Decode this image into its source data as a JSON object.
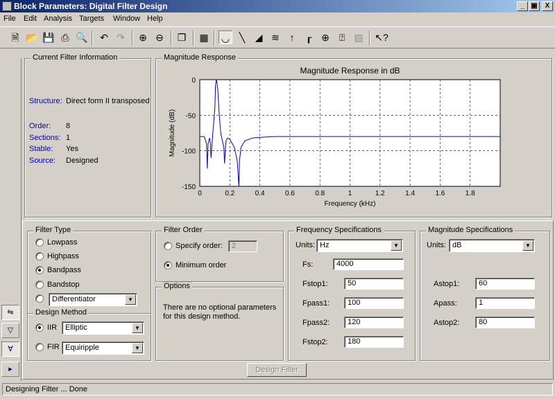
{
  "window": {
    "title": "Block Parameters: Digital Filter Design",
    "controls": [
      "_",
      "▣",
      "X"
    ]
  },
  "menu": [
    "File",
    "Edit",
    "Analysis",
    "Targets",
    "Window",
    "Help"
  ],
  "toolbar_icons": [
    "new-icon",
    "open-icon",
    "save-icon",
    "print-icon",
    "print-preview-icon",
    "undo-icon",
    "redo-icon",
    "zoom-in-icon",
    "zoom-out-icon",
    "full-view-icon",
    "filter-structure-icon",
    "magnitude-response-icon",
    "phase-response-icon",
    "magnitude-phase-icon",
    "group-delay-icon",
    "impulse-response-icon",
    "step-response-icon",
    "pole-zero-icon",
    "filter-coefficients-icon",
    "filter-information-icon",
    "whats-this-help-icon"
  ],
  "filter_info": {
    "title": "Current Filter Information",
    "structure_label": "Structure:",
    "structure_value": "Direct form II transposed",
    "order_label": "Order:",
    "order_value": "8",
    "sections_label": "Sections:",
    "sections_value": "1",
    "stable_label": "Stable:",
    "stable_value": "Yes",
    "source_label": "Source:",
    "source_value": "Designed"
  },
  "magnitude": {
    "group_title": "Magnitude Response",
    "chart_data": {
      "type": "line",
      "title": "Magnitude Response in dB",
      "xlabel": "Frequency (kHz)",
      "ylabel": "Magnitude (dB)",
      "xlim": [
        0,
        2
      ],
      "ylim": [
        -150,
        0
      ],
      "x_ticks": [
        "0",
        "0.2",
        "0.4",
        "0.6",
        "0.8",
        "1",
        "1.2",
        "1.4",
        "1.6",
        "1.8"
      ],
      "y_ticks": [
        "0",
        "-50",
        "-100",
        "-150"
      ],
      "grid": true,
      "color": "#0000c0",
      "series": [
        {
          "x": [
            0,
            0.03,
            0.045,
            0.05,
            0.055,
            0.065,
            0.07,
            0.075,
            0.085,
            0.1,
            0.105,
            0.11,
            0.115,
            0.12,
            0.13,
            0.14,
            0.16,
            0.165,
            0.17,
            0.175,
            0.185,
            0.2,
            0.23,
            0.25,
            0.26,
            0.265,
            0.275,
            0.3,
            0.35,
            0.4,
            0.5,
            0.6,
            0.8,
            1.0,
            1.2,
            1.4,
            1.6,
            1.8,
            2.0
          ],
          "y": [
            -80,
            -80,
            -90,
            -125,
            -90,
            -82,
            -88,
            -110,
            -80,
            -40,
            -8,
            0,
            -5,
            -15,
            -50,
            -76,
            -95,
            -118,
            -98,
            -86,
            -82,
            -84,
            -95,
            -115,
            -150,
            -112,
            -95,
            -86,
            -82,
            -81,
            -80,
            -80,
            -80,
            -80,
            -80,
            -80,
            -80,
            -80,
            -80
          ]
        }
      ]
    }
  },
  "filter_type": {
    "title": "Filter Type",
    "options": [
      "Lowpass",
      "Highpass",
      "Bandpass",
      "Bandstop"
    ],
    "selected": "Bandpass",
    "other_value": "Differentiator"
  },
  "design_method": {
    "title": "Design Method",
    "iir_label": "IIR",
    "iir_value": "Elliptic",
    "fir_label": "FIR",
    "fir_value": "Equiripple",
    "selected": "IIR"
  },
  "filter_order": {
    "title": "Filter Order",
    "specify_label": "Specify order:",
    "specify_value": "2",
    "minimum_label": "Minimum order",
    "selected": "Minimum order"
  },
  "options": {
    "title": "Options",
    "text_line1": "There are no optional parameters",
    "text_line2": "for this design method."
  },
  "freq_specs": {
    "title": "Frequency Specifications",
    "units_label": "Units:",
    "units_value": "Hz",
    "fields": [
      {
        "label": "Fs:",
        "value": "4000"
      },
      {
        "label": "Fstop1:",
        "value": "50"
      },
      {
        "label": "Fpass1:",
        "value": "100"
      },
      {
        "label": "Fpass2:",
        "value": "120"
      },
      {
        "label": "Fstop2:",
        "value": "180"
      }
    ]
  },
  "mag_specs": {
    "title": "Magnitude Specifications",
    "units_label": "Units:",
    "units_value": "dB",
    "fields": [
      {
        "label": "Astop1:",
        "value": "60"
      },
      {
        "label": "Apass:",
        "value": "1"
      },
      {
        "label": "Astop2:",
        "value": "80"
      }
    ]
  },
  "design_button": "Design Filter",
  "status": "Designing Filter ... Done"
}
